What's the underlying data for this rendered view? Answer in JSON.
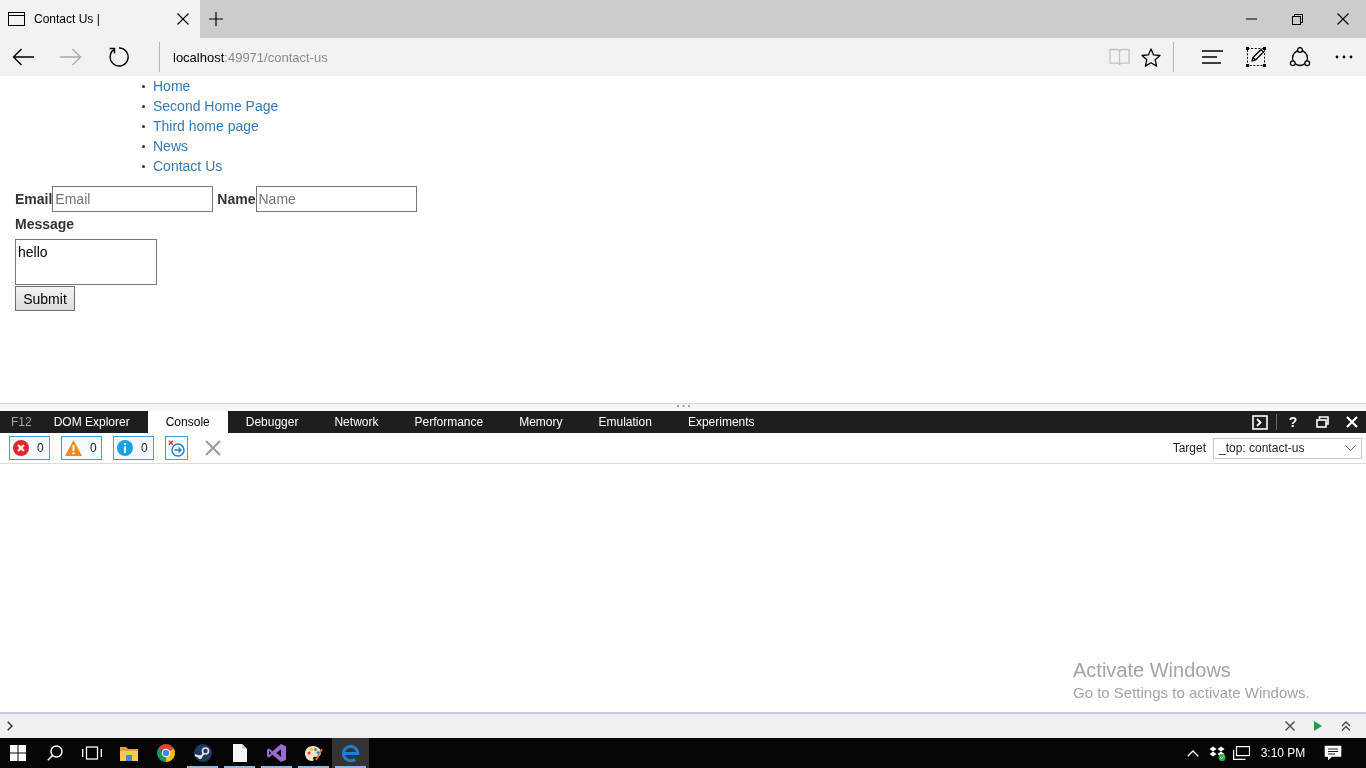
{
  "browser": {
    "tabs": [
      {
        "title": "Contact Us |",
        "selected": true
      }
    ],
    "nav_buttons": [
      {
        "kind": "back",
        "disabled": false
      },
      {
        "kind": "forward",
        "disabled": true
      },
      {
        "kind": "refresh",
        "disabled": false
      }
    ],
    "address": {
      "host": "localhost",
      "path": ":49971/contact-us"
    },
    "page_tools": [
      {
        "kind": "reading-view",
        "disabled": true
      },
      {
        "kind": "favorite",
        "disabled": false
      }
    ],
    "app_tools": [
      {
        "kind": "hub"
      },
      {
        "kind": "web-note"
      },
      {
        "kind": "share"
      },
      {
        "kind": "more"
      }
    ]
  },
  "page": {
    "nav_links": [
      "Home",
      "Second Home Page",
      "Third home page",
      "News",
      "Contact Us"
    ],
    "form": {
      "fields": [
        {
          "label": "Email",
          "placeholder": "Email"
        },
        {
          "label": "Name",
          "placeholder": "Name"
        }
      ],
      "message": {
        "label": "Message",
        "value": "hello"
      },
      "submit": "Submit"
    }
  },
  "devtools": {
    "shortcut": "F12",
    "tabs": [
      {
        "label": "DOM Explorer",
        "selected": false
      },
      {
        "label": "Console",
        "selected": true
      },
      {
        "label": "Debugger",
        "selected": false
      },
      {
        "label": "Network",
        "selected": false
      },
      {
        "label": "Performance",
        "selected": false
      },
      {
        "label": "Memory",
        "selected": false
      },
      {
        "label": "Emulation",
        "selected": false
      },
      {
        "label": "Experiments",
        "selected": false
      }
    ],
    "help": "?",
    "counters": [
      {
        "kind": "error",
        "count": "0",
        "on": true
      },
      {
        "kind": "warning",
        "count": "0",
        "on": true
      },
      {
        "kind": "info",
        "count": "0",
        "on": true
      }
    ],
    "clear_on_navigate": {
      "on": true
    },
    "target": {
      "label": "Target",
      "value": "_top: contact-us"
    }
  },
  "system_notice": {
    "title": "Activate Windows",
    "text": "Go to Settings to activate Windows."
  },
  "taskbar": {
    "apps": [
      {
        "kind": "file-explorer",
        "running": false,
        "selected": false
      },
      {
        "kind": "chrome",
        "running": false,
        "selected": false
      },
      {
        "kind": "steam",
        "running": true,
        "selected": false
      },
      {
        "kind": "document",
        "running": true,
        "selected": false
      },
      {
        "kind": "visual-studio",
        "running": true,
        "selected": false
      },
      {
        "kind": "paint",
        "running": true,
        "selected": false
      },
      {
        "kind": "edge",
        "running": true,
        "selected": true
      }
    ],
    "clock": "3:10 PM"
  }
}
